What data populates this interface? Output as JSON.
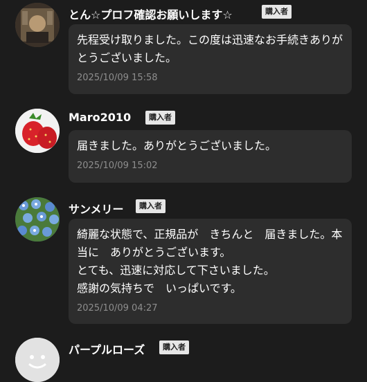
{
  "badge_label": "購入者",
  "reviews": [
    {
      "name": "とん☆プロフ確認お願いします☆",
      "avatar_icon": "photo-avatar-icon",
      "message": "先程受け取りました。この度は迅速なお手続きありがとうございました。",
      "time": "2025/10/09 15:58"
    },
    {
      "name": "Maro2010",
      "avatar_icon": "strawberry-avatar-icon",
      "message": "届きました。ありがとうございました。",
      "time": "2025/10/09 15:02"
    },
    {
      "name": "サンメリー",
      "avatar_icon": "flowers-avatar-icon",
      "message": "綺麗な状態で、正規品が　きちんと　届きました。本当に　ありがとうございます。\nとても、迅速に対応して下さいました。\n感謝の気持ちで　いっぱいです。",
      "time": "2025/10/09 04:27"
    },
    {
      "name": "パープルローズ",
      "avatar_icon": "default-face-avatar-icon",
      "message": "",
      "time": ""
    }
  ]
}
